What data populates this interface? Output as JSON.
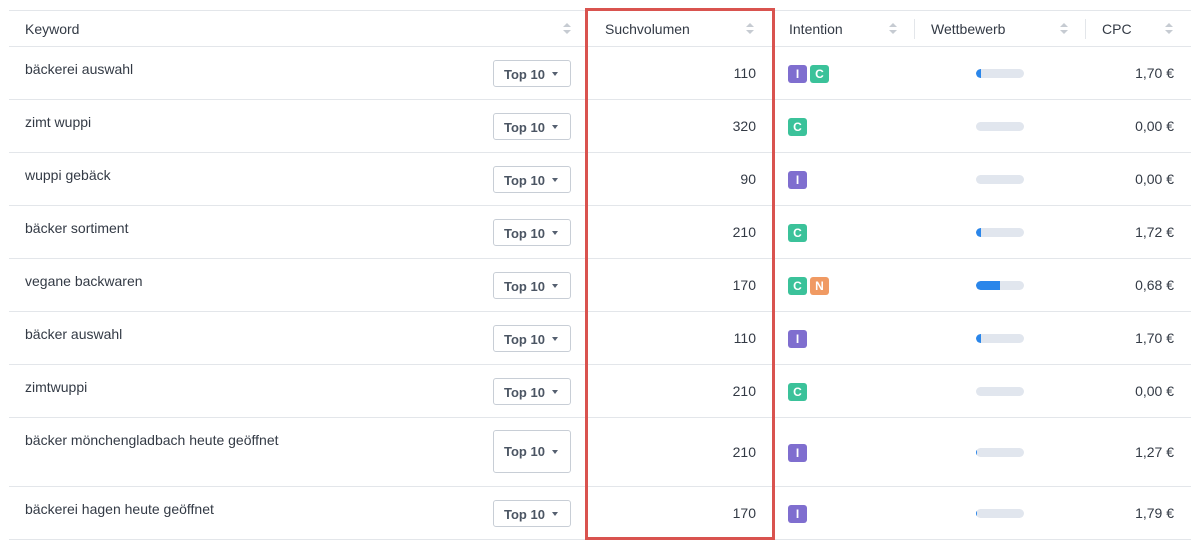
{
  "columns": {
    "keyword": "Keyword",
    "volume": "Suchvolumen",
    "intent": "Intention",
    "competition": "Wettbewerb",
    "cpc": "CPC"
  },
  "colors": {
    "I": "#7f6ecf",
    "C": "#3bc29a",
    "N": "#f09a63",
    "highlight": "#d9534f",
    "bar_fill": "#2a86ea"
  },
  "rows": [
    {
      "keyword": "bäckerei auswahl",
      "position": "Top 10",
      "volume": "110",
      "intents": [
        "I",
        "C"
      ],
      "competition": 0.1,
      "cpc": "1,70 €"
    },
    {
      "keyword": "zimt wuppi",
      "position": "Top 10",
      "volume": "320",
      "intents": [
        "C"
      ],
      "competition": 0,
      "cpc": "0,00 €"
    },
    {
      "keyword": "wuppi gebäck",
      "position": "Top 10",
      "volume": "90",
      "intents": [
        "I"
      ],
      "competition": 0,
      "cpc": "0,00 €"
    },
    {
      "keyword": "bäcker sortiment",
      "position": "Top 10",
      "volume": "210",
      "intents": [
        "C"
      ],
      "competition": 0.1,
      "cpc": "1,72 €"
    },
    {
      "keyword": "vegane backwaren",
      "position": "Top 10",
      "volume": "170",
      "intents": [
        "C",
        "N"
      ],
      "competition": 0.5,
      "cpc": "0,68 €"
    },
    {
      "keyword": "bäcker auswahl",
      "position": "Top 10",
      "volume": "110",
      "intents": [
        "I"
      ],
      "competition": 0.1,
      "cpc": "1,70 €"
    },
    {
      "keyword": "zimtwuppi",
      "position": "Top 10",
      "volume": "210",
      "intents": [
        "C"
      ],
      "competition": 0,
      "cpc": "0,00 €"
    },
    {
      "keyword": "bäcker mönchengladbach heute geöffnet",
      "position": "Top 10",
      "volume": "210",
      "intents": [
        "I"
      ],
      "competition": 0.03,
      "cpc": "1,27 €"
    },
    {
      "keyword": "bäckerei hagen heute geöffnet",
      "position": "Top 10",
      "volume": "170",
      "intents": [
        "I"
      ],
      "competition": 0.03,
      "cpc": "1,79 €"
    }
  ]
}
